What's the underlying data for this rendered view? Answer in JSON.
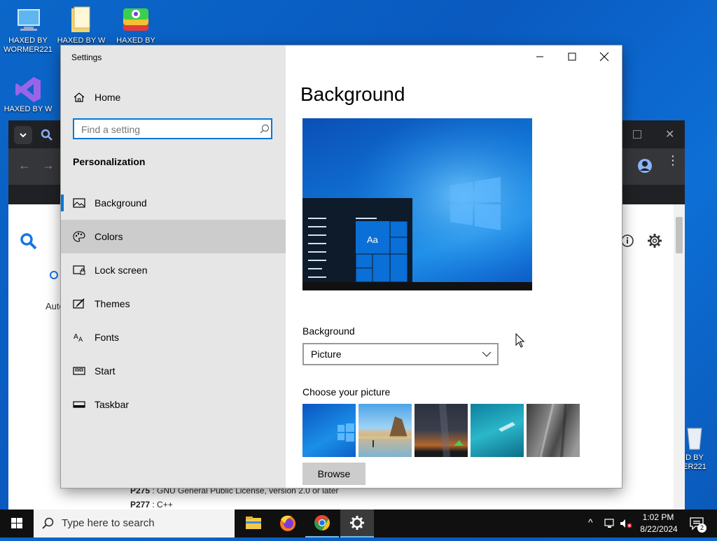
{
  "desktop": {
    "icons": [
      {
        "label": "HAXED BY WORMER221",
        "icon": "this-pc-icon"
      },
      {
        "label": "HAXED BY W",
        "icon": "folder-icon"
      },
      {
        "label": "HAXED BY",
        "icon": "bluestacks-icon"
      },
      {
        "label": "HAXED BY W",
        "icon": "visual-studio-icon"
      },
      {
        "label": "D BY ER221",
        "icon": "recycle-bin-icon"
      }
    ]
  },
  "browser": {
    "left_text": "Auto",
    "lines": [
      {
        "id": "P275",
        "text": "GNU General Public License, version 2.0 or later"
      },
      {
        "id": "P277",
        "text": "C++"
      }
    ]
  },
  "settings": {
    "window_title": "Settings",
    "home_label": "Home",
    "search_placeholder": "Find a setting",
    "section_title": "Personalization",
    "nav_items": [
      {
        "label": "Background",
        "icon": "picture-icon",
        "selected": true
      },
      {
        "label": "Colors",
        "icon": "palette-icon",
        "hovered": true
      },
      {
        "label": "Lock screen",
        "icon": "lock-screen-icon"
      },
      {
        "label": "Themes",
        "icon": "themes-icon"
      },
      {
        "label": "Fonts",
        "icon": "fonts-icon"
      },
      {
        "label": "Start",
        "icon": "start-icon"
      },
      {
        "label": "Taskbar",
        "icon": "taskbar-icon"
      }
    ],
    "page_title": "Background",
    "preview_tile_text": "Aa",
    "background_label": "Background",
    "background_value": "Picture",
    "choose_picture_label": "Choose your picture",
    "pictures": [
      "windows-blue",
      "beach-rocks",
      "night-sky-tent",
      "underwater-swimmer",
      "rock-cliff"
    ],
    "browse_label": "Browse"
  },
  "taskbar": {
    "search_placeholder": "Type here to search",
    "apps": [
      "file-explorer-icon",
      "firefox-icon",
      "chrome-icon",
      "settings-gear-icon"
    ],
    "time": "1:02 PM",
    "date": "8/22/2024",
    "notification_count": "2"
  }
}
